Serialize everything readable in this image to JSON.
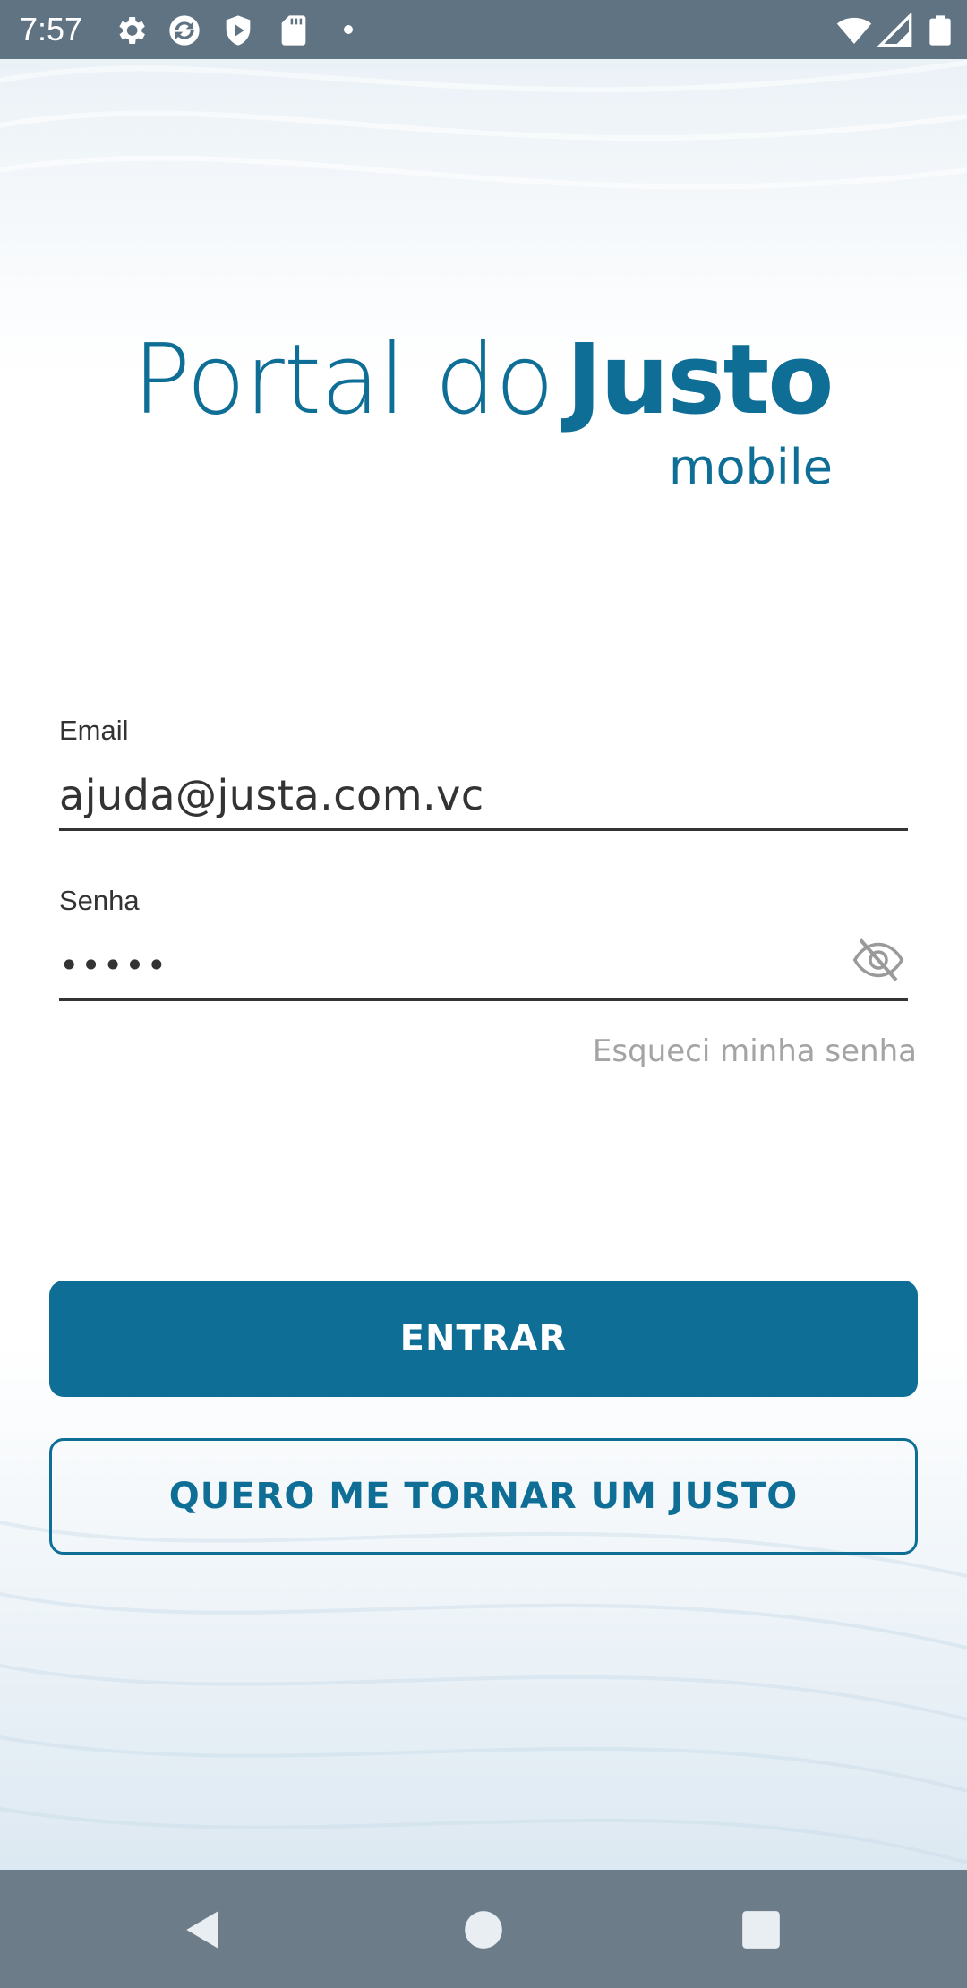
{
  "status_bar": {
    "time": "7:57",
    "left_icons": [
      "gear-icon",
      "sync-icon",
      "shield-icon",
      "sd-card-icon"
    ],
    "right_icons": [
      "wifi-icon",
      "signal-icon",
      "battery-icon"
    ]
  },
  "logo": {
    "light_text": "Portal do",
    "bold_text": "Justo",
    "subtitle": "mobile"
  },
  "form": {
    "email_label": "Email",
    "email_value": "ajuda@justa.com.vc",
    "password_label": "Senha",
    "password_value": "•••••",
    "forgot_password": "Esqueci minha senha"
  },
  "buttons": {
    "login": "ENTRAR",
    "signup": "QUERO ME TORNAR UM JUSTO"
  },
  "nav_bar": {
    "buttons": [
      "back-icon",
      "home-icon",
      "recents-icon"
    ]
  },
  "colors": {
    "brand": "#0e6e96",
    "muted_text": "#a4a4a4",
    "status_bar": "#5f7382"
  }
}
